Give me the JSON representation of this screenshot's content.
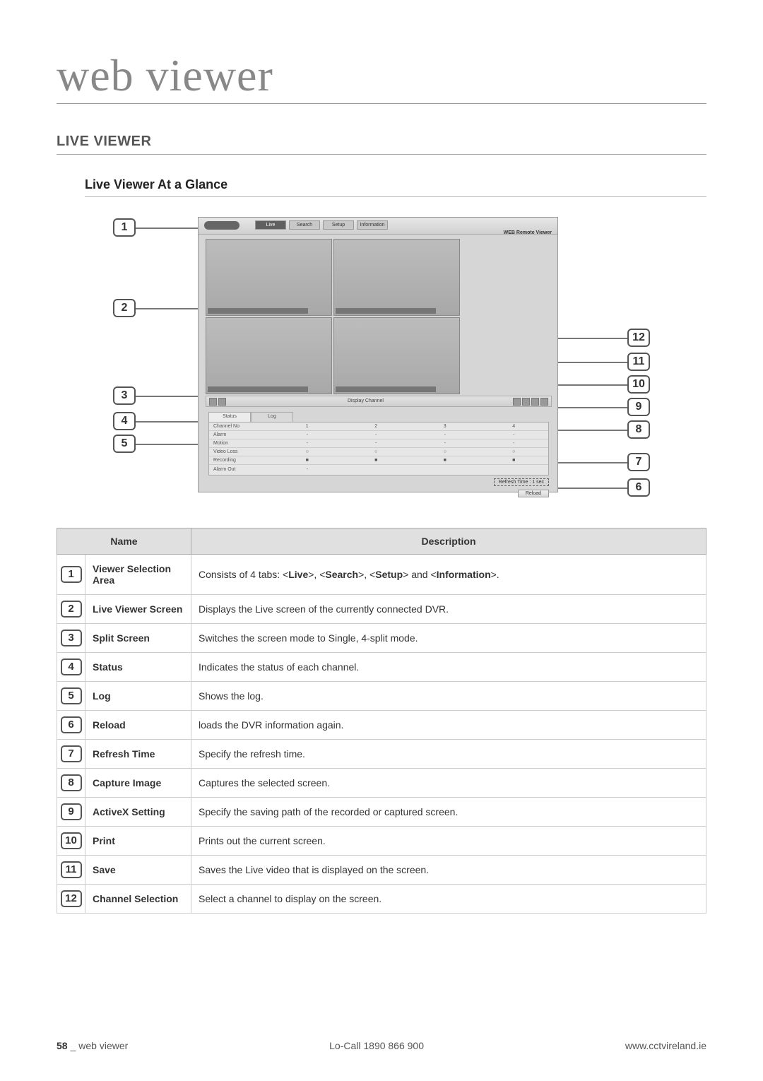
{
  "page_title": "web viewer",
  "section_heading": "LIVE VIEWER",
  "subsection_heading": "Live Viewer At a Glance",
  "screenshot": {
    "top_right_label": "WEB Remote Viewer",
    "tabs": [
      "Live",
      "Search",
      "Setup",
      "Information"
    ],
    "mini_bar_label": "Display Channel",
    "status_tab": "Status",
    "log_tab": "Log",
    "status_rows": {
      "channel": {
        "label": "Channel No",
        "cells": [
          "1",
          "2",
          "3",
          "4"
        ]
      },
      "alarm": {
        "label": "Alarm",
        "cells": [
          "-",
          "-",
          "-",
          "-"
        ]
      },
      "motion": {
        "label": "Motion",
        "cells": [
          "-",
          "-",
          "-",
          "-"
        ]
      },
      "videoloss": {
        "label": "Video Loss",
        "cells": [
          "○",
          "○",
          "○",
          "○"
        ]
      },
      "recording": {
        "label": "Recording",
        "cells": [
          "■",
          "■",
          "■",
          "■"
        ]
      },
      "alarmout": {
        "label": "Alarm Out",
        "cells": [
          "-",
          "",
          "",
          ""
        ]
      }
    },
    "refresh_label": "Refresh Time : 1 sec",
    "reload_label": "Reload"
  },
  "callouts_left": [
    "1",
    "2",
    "3",
    "4",
    "5"
  ],
  "callouts_right": [
    "12",
    "11",
    "10",
    "9",
    "8",
    "7",
    "6"
  ],
  "table_header": {
    "name": "Name",
    "description": "Description"
  },
  "rows": [
    {
      "num": "1",
      "name": "Viewer Selection Area",
      "desc_prefix": "Consists of 4 tabs: <",
      "t1": "Live",
      "sep": ">, <",
      "t2": "Search",
      "t3": "Setup",
      "sep_and": "> and <",
      "t4": "Information",
      "desc_suffix": ">."
    },
    {
      "num": "2",
      "name": "Live Viewer Screen",
      "desc": "Displays the Live screen of the currently connected DVR."
    },
    {
      "num": "3",
      "name": "Split Screen",
      "desc": "Switches the screen mode to Single, 4-split mode."
    },
    {
      "num": "4",
      "name": "Status",
      "desc": "Indicates the status of each channel."
    },
    {
      "num": "5",
      "name": "Log",
      "desc": "Shows the log."
    },
    {
      "num": "6",
      "name": "Reload",
      "desc": "loads the DVR information again."
    },
    {
      "num": "7",
      "name": "Refresh Time",
      "desc": "Specify the refresh time."
    },
    {
      "num": "8",
      "name": "Capture Image",
      "desc": "Captures the selected screen."
    },
    {
      "num": "9",
      "name": "ActiveX Setting",
      "desc": "Specify the saving path of the recorded or captured screen."
    },
    {
      "num": "10",
      "name": "Print",
      "desc": "Prints out the current screen."
    },
    {
      "num": "11",
      "name": "Save",
      "desc": "Saves the Live video that is displayed on the screen."
    },
    {
      "num": "12",
      "name": "Channel Selection",
      "desc": "Select a channel to display on the screen."
    }
  ],
  "footer": {
    "page_number": "58",
    "section_label": "web viewer",
    "center_text": "Lo-Call  1890 866 900",
    "right_text": "www.cctvireland.ie"
  }
}
